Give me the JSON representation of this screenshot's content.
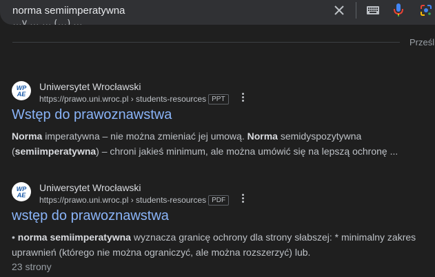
{
  "search": {
    "query": "norma semiimperatywna",
    "clear_icon": "close-icon",
    "keyboard_icon": "keyboard-icon",
    "mic_icon": "microphone-icon",
    "lens_icon": "google-lens-icon"
  },
  "top": {
    "cut_text": "…y … … (…) …",
    "more_label": "Prześli"
  },
  "results": [
    {
      "site_name": "Uniwersytet Wrocławski",
      "url": "https://prawo.uni.wroc.pl › students-resources",
      "file_type": "PPT",
      "title": "Wstęp do prawoznawstwa",
      "snippet_parts": [
        {
          "b": true,
          "t": "Norma"
        },
        {
          "b": false,
          "t": " imperatywna – nie można zmieniać jej umową. "
        },
        {
          "b": true,
          "t": "Norma"
        },
        {
          "b": false,
          "t": " semidyspozytywna ("
        },
        {
          "b": true,
          "t": "semiimperatywna"
        },
        {
          "b": false,
          "t": ") – chroni jakieś minimum, ale można umówić się na lepszą ochronę ..."
        }
      ]
    },
    {
      "site_name": "Uniwersytet Wrocławski",
      "url": "https://prawo.uni.wroc.pl › students-resources",
      "file_type": "PDF",
      "title": "wstęp do prawoznawstwa",
      "snippet_parts": [
        {
          "b": false,
          "t": "• "
        },
        {
          "b": true,
          "t": "norma semiimperatywna"
        },
        {
          "b": false,
          "t": " wyznacza granicę ochrony dla strony słabszej: * minimalny zakres uprawnień (którego nie można ograniczyć, ale można rozszerzyć) lub."
        }
      ],
      "pages": "23 strony"
    }
  ],
  "favicon": {
    "text_top": "WP",
    "text_bottom": "AE",
    "color": "#1a5aa8"
  }
}
